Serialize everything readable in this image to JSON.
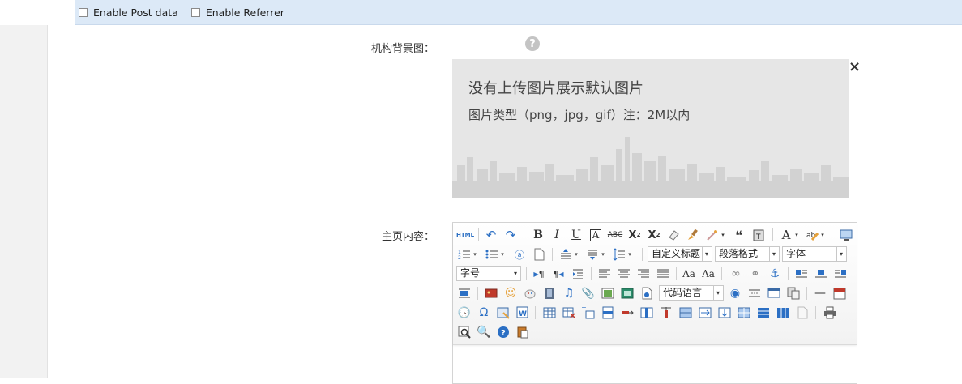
{
  "debug_bar": {
    "options": [
      {
        "label": "Enable Post data",
        "checked": false
      },
      {
        "label": "Enable Referrer",
        "checked": false
      }
    ]
  },
  "form": {
    "bg_label": "机构背景图：",
    "content_label": "主页内容："
  },
  "default_image": {
    "line1": "没有上传图片展示默认图片",
    "line2": "图片类型（png，jpg，gif）注：2M以内"
  },
  "help_icon_text": "?",
  "close_text": "×",
  "editor": {
    "html_label": "HTML",
    "font_color_label": "A",
    "combos": {
      "custom_title": "自定义标题",
      "paragraph": "段落格式",
      "font": "字体",
      "font_size": "字号",
      "code_lang": "代码语言"
    }
  },
  "colors": {
    "topbar": "#dce9f7",
    "image_bg": "#e6e6e6",
    "accent_blue": "#2b6fc4"
  }
}
